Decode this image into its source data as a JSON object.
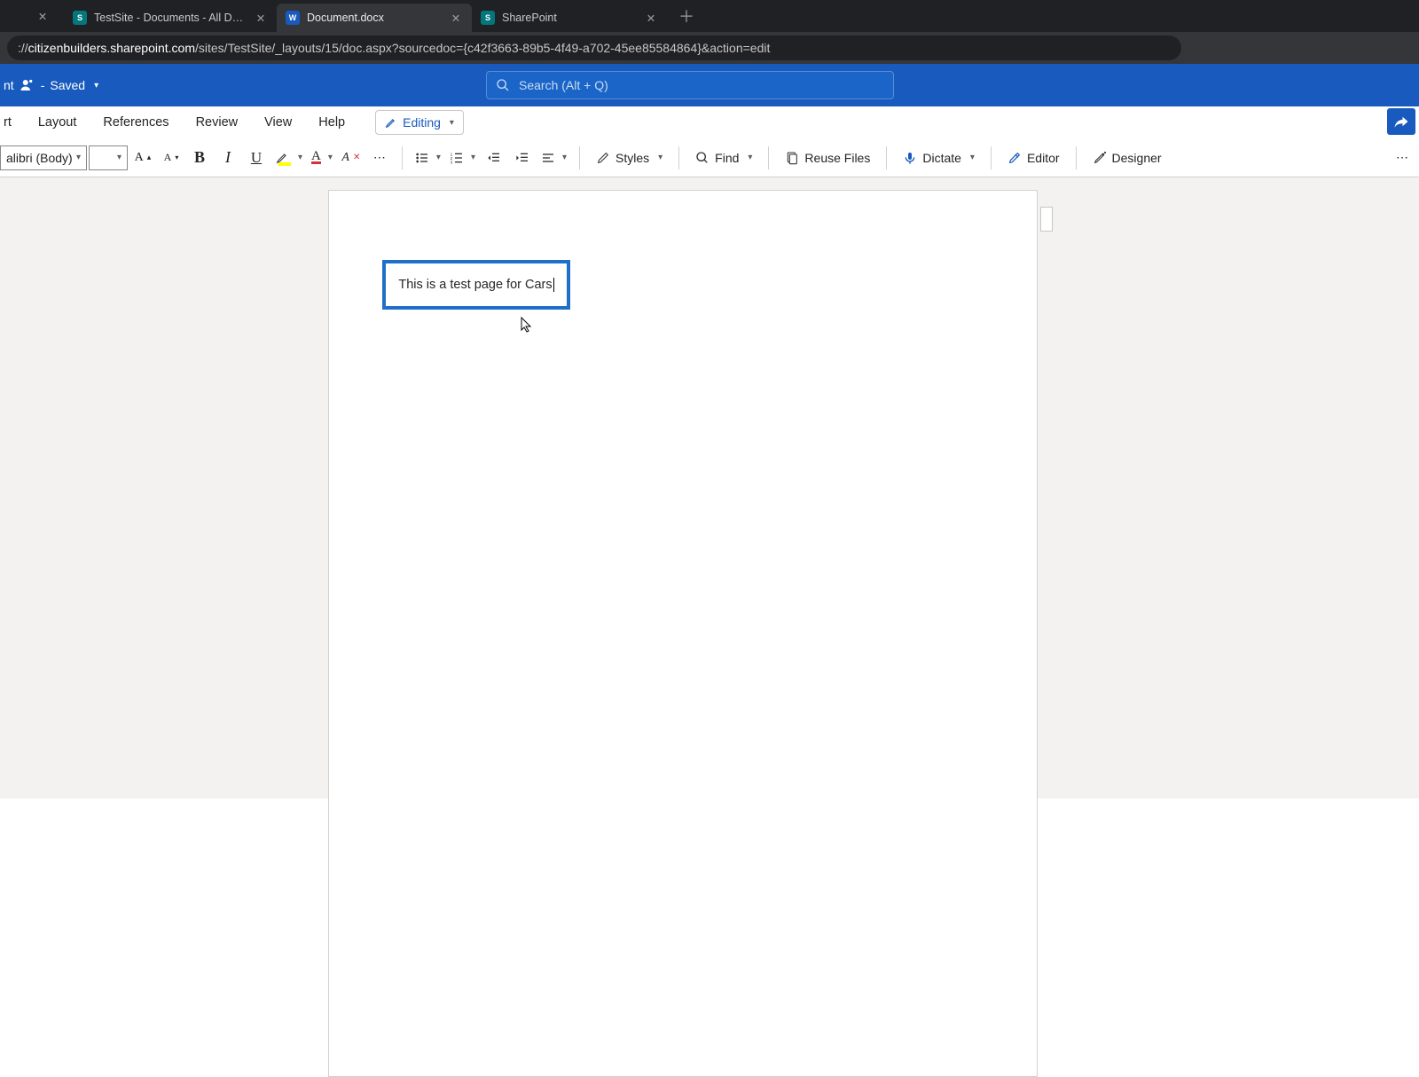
{
  "browser": {
    "tabs": [
      {
        "title": "TestSite - Documents - All Docum",
        "fav": "sp"
      },
      {
        "title": "Document.docx",
        "fav": "word",
        "active": true
      },
      {
        "title": "SharePoint",
        "fav": "sp"
      }
    ],
    "url_prefix": ":// ",
    "url_host": "citizenbuilders.sharepoint.com",
    "url_path": "/sites/TestSite/_layouts/15/doc.aspx?sourcedoc={c42f3663-89b5-4f49-a702-45ee85584864}&action=edit"
  },
  "titleBar": {
    "docTail": "nt",
    "saveState": "Saved"
  },
  "search": {
    "placeholder": "Search (Alt + Q)"
  },
  "ribbon": {
    "tabs": [
      "rt",
      "Layout",
      "References",
      "Review",
      "View",
      "Help"
    ],
    "modeLabel": "Editing"
  },
  "toolbar": {
    "fontName": "alibri (Body)",
    "styles": "Styles",
    "find": "Find",
    "reuse": "Reuse Files",
    "dictate": "Dictate",
    "editor": "Editor",
    "designer": "Designer"
  },
  "document": {
    "textboxContent": "This is a test page for Cars"
  }
}
